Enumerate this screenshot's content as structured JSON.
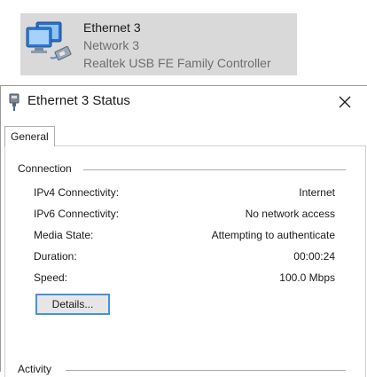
{
  "connection_tile": {
    "name": "Ethernet 3",
    "network": "Network 3",
    "adapter": "Realtek USB FE Family Controller"
  },
  "dialog": {
    "title": "Ethernet 3 Status",
    "tabs": [
      {
        "label": "General",
        "selected": true
      }
    ],
    "connection_group": {
      "label": "Connection",
      "rows": [
        {
          "label": "IPv4 Connectivity:",
          "value": "Internet"
        },
        {
          "label": "IPv6 Connectivity:",
          "value": "No network access"
        },
        {
          "label": "Media State:",
          "value": "Attempting to authenticate"
        },
        {
          "label": "Duration:",
          "value": "00:00:24"
        },
        {
          "label": "Speed:",
          "value": "100.0 Mbps"
        }
      ],
      "details_button": "Details..."
    },
    "activity_group": {
      "label": "Activity"
    }
  },
  "icons": {
    "connection": "network-adapter-icon",
    "title": "ethernet-plug-icon",
    "close": "close-icon"
  },
  "colors": {
    "tile_selected_bg": "#d9d9d9",
    "button_focus_border": "#4a90d9"
  }
}
